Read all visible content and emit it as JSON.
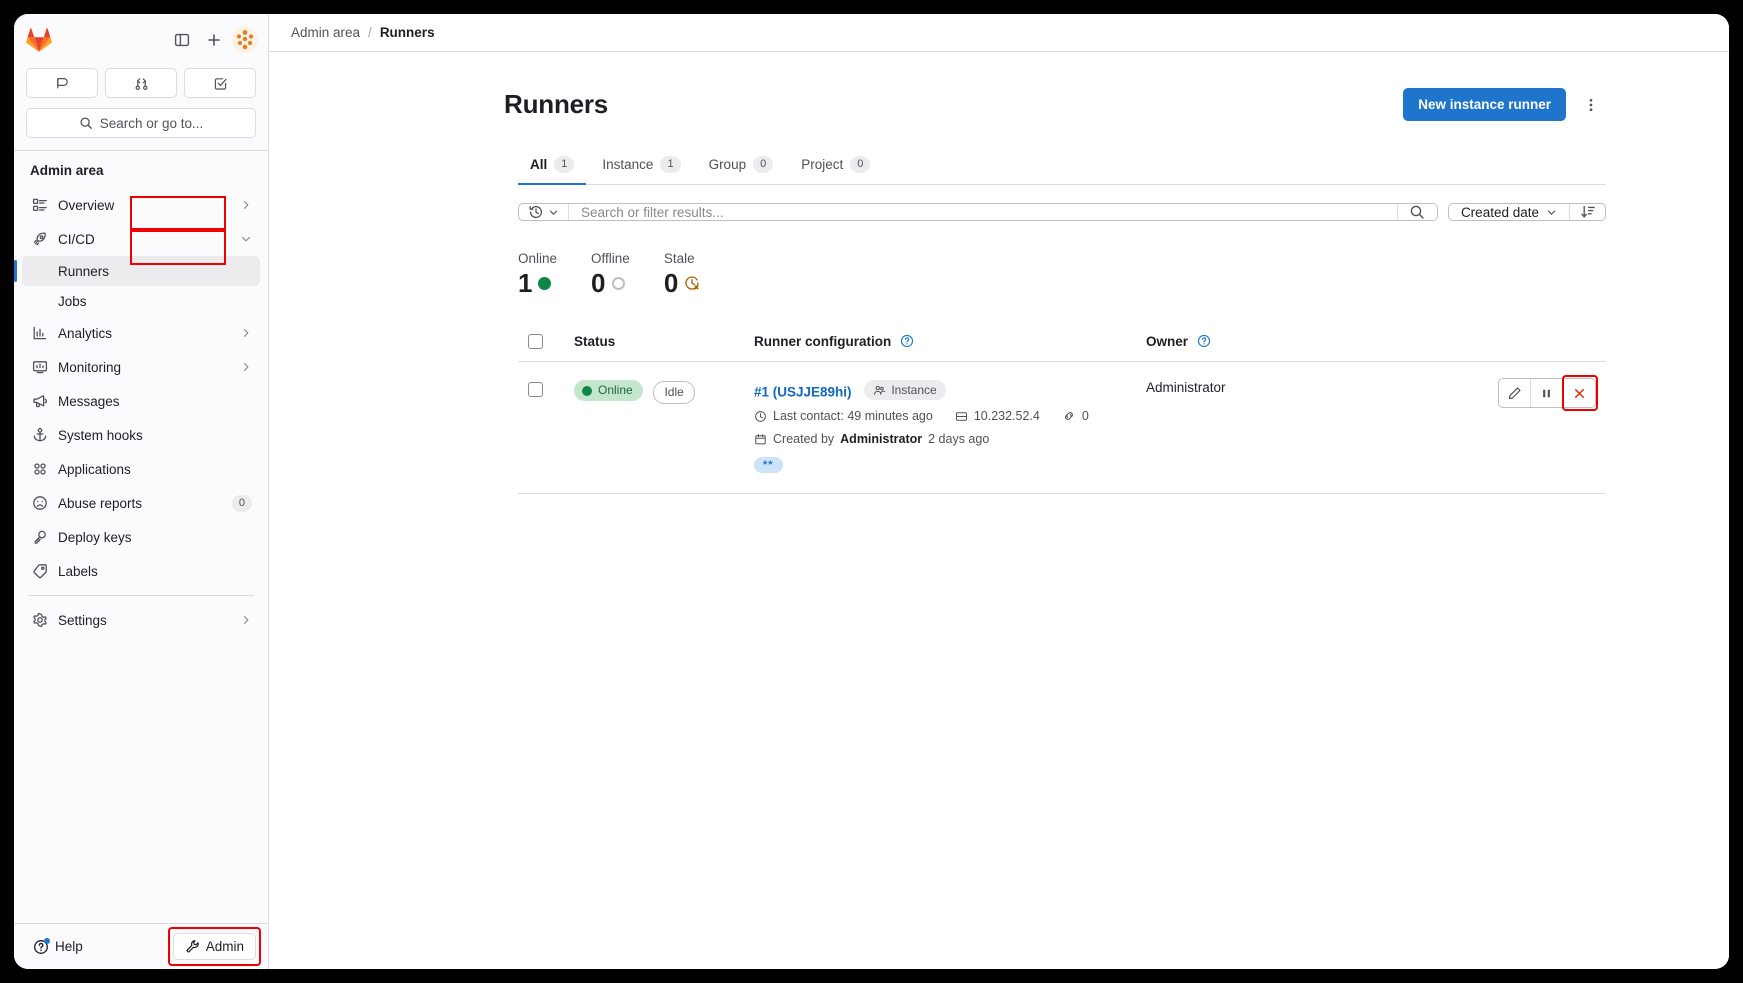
{
  "sidebar": {
    "brand_icon": "gitlab-logo",
    "top_icons": [
      {
        "name": "toggle-sidebar-icon",
        "label": "Toggle sidebar"
      },
      {
        "name": "new-item-icon",
        "label": "Create new..."
      },
      {
        "name": "user-avatar",
        "label": "User menu"
      }
    ],
    "quick_buttons": [
      {
        "name": "issues-icon",
        "label": "Issues"
      },
      {
        "name": "merge-requests-icon",
        "label": "Merge requests"
      },
      {
        "name": "todos-icon",
        "label": "To-Do list"
      }
    ],
    "search_placeholder": "Search or go to...",
    "heading": "Admin area",
    "items": [
      {
        "label": "Overview",
        "icon": "overview-icon",
        "chevron": "right",
        "badge": null
      },
      {
        "label": "CI/CD",
        "icon": "rocket-icon",
        "chevron": "down",
        "badge": null
      },
      {
        "label": "Runners",
        "icon": null,
        "sub": true,
        "active": true
      },
      {
        "label": "Jobs",
        "icon": null,
        "sub": true,
        "active": false
      },
      {
        "label": "Analytics",
        "icon": "analytics-icon",
        "chevron": "right",
        "badge": null
      },
      {
        "label": "Monitoring",
        "icon": "monitoring-icon",
        "chevron": "right",
        "badge": null
      },
      {
        "label": "Messages",
        "icon": "megaphone-icon",
        "chevron": null,
        "badge": null
      },
      {
        "label": "System hooks",
        "icon": "anchor-icon",
        "chevron": null,
        "badge": null
      },
      {
        "label": "Applications",
        "icon": "applications-icon",
        "chevron": null,
        "badge": null
      },
      {
        "label": "Abuse reports",
        "icon": "abuse-icon",
        "chevron": null,
        "badge": "0"
      },
      {
        "label": "Deploy keys",
        "icon": "key-icon",
        "chevron": null,
        "badge": null
      },
      {
        "label": "Labels",
        "icon": "label-icon",
        "chevron": null,
        "badge": null
      },
      {
        "label": "Settings",
        "icon": "gear-icon",
        "chevron": "right",
        "badge": null
      }
    ],
    "footer": {
      "help_label": "Help",
      "admin_label": "Admin"
    }
  },
  "breadcrumb": {
    "root": "Admin area",
    "separator": "/",
    "current": "Runners"
  },
  "page": {
    "title": "Runners",
    "primary_button": "New instance runner",
    "kebab_label": "More actions"
  },
  "tabs": [
    {
      "label": "All",
      "count": "1",
      "active": true
    },
    {
      "label": "Instance",
      "count": "1",
      "active": false
    },
    {
      "label": "Group",
      "count": "0",
      "active": false
    },
    {
      "label": "Project",
      "count": "0",
      "active": false
    }
  ],
  "filters": {
    "history_icon": "history-icon",
    "search_placeholder": "Search or filter results...",
    "search_value": "",
    "search_icon": "search-icon",
    "sort_by": "Created date",
    "sort_direction_icon": "sort-descending-icon"
  },
  "stats": [
    {
      "label": "Online",
      "value": "1",
      "icon": "filled-circle",
      "color": "#108548"
    },
    {
      "label": "Offline",
      "value": "0",
      "icon": "hollow-circle",
      "color": "#bfbfc3"
    },
    {
      "label": "Stale",
      "value": "0",
      "icon": "stale-clock",
      "color": "#ab6100"
    }
  ],
  "table": {
    "columns": {
      "status": "Status",
      "config": "Runner configuration",
      "config_help": "?",
      "owner": "Owner",
      "owner_help": "?"
    },
    "rows": [
      {
        "status_badge": "Online",
        "job_status": "Idle",
        "name": "#1 (USJJE89hi)",
        "scope_chip": "Instance",
        "last_contact": "Last contact: 49 minutes ago",
        "ip_address": "10.232.52.4",
        "job_count": "0",
        "created_prefix": "Created by",
        "created_by": "Administrator",
        "created_suffix": "2 days ago",
        "tag": "**",
        "owner": "Administrator",
        "actions": [
          {
            "name": "edit-runner-button",
            "icon": "pencil-icon"
          },
          {
            "name": "pause-runner-button",
            "icon": "pause-icon"
          },
          {
            "name": "delete-runner-button",
            "icon": "close-icon"
          }
        ]
      }
    ]
  },
  "annotations": {
    "highlight_color": "#ee0000"
  }
}
